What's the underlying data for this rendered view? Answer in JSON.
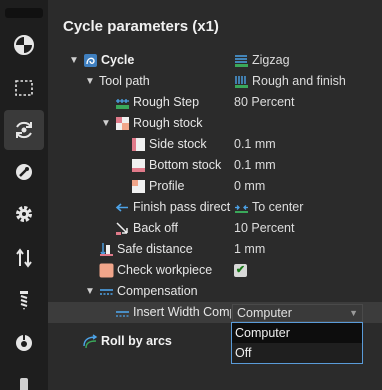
{
  "title": "Cycle parameters (x1)",
  "sidebar": {
    "icons": [
      "quadrant-icon",
      "dashed-rect-icon",
      "cycle-rotate-icon",
      "wrench-icon",
      "gear-icon",
      "transfer-arrows-icon",
      "drill-bit-icon",
      "spindle-icon"
    ],
    "active_index": 2
  },
  "tree": {
    "cycle": {
      "label": "Cycle",
      "value": "Zigzag"
    },
    "tool_path": {
      "label": "Tool path",
      "value": "Rough and finish"
    },
    "rough_step": {
      "label": "Rough Step",
      "value": "80 Percent"
    },
    "rough_stock": {
      "label": "Rough stock"
    },
    "side_stock": {
      "label": "Side stock",
      "value": "0.1 mm"
    },
    "bottom_stock": {
      "label": "Bottom stock",
      "value": "0.1 mm"
    },
    "profile": {
      "label": "Profile",
      "value": "0 mm"
    },
    "finish_pass": {
      "label": "Finish pass direction",
      "value": "To center"
    },
    "back_off": {
      "label": "Back off",
      "value": "10 Percent"
    },
    "safe_distance": {
      "label": "Safe distance",
      "value": "1 mm"
    },
    "check_workpiece": {
      "label": "Check workpiece",
      "checked": true
    },
    "compensation": {
      "label": "Compensation"
    },
    "insert_width": {
      "label": "Insert Width Compensation",
      "value": "Computer"
    },
    "roll_by_arcs": {
      "label": "Roll by arcs"
    }
  },
  "dropdown": {
    "options": [
      "Computer",
      "Off"
    ],
    "selected": "Computer"
  },
  "colors": {
    "accent_blue": "#4da3e8",
    "accent_green": "#3aa85a",
    "salmon": "#f0a58a",
    "pink": "#e07a8a"
  }
}
